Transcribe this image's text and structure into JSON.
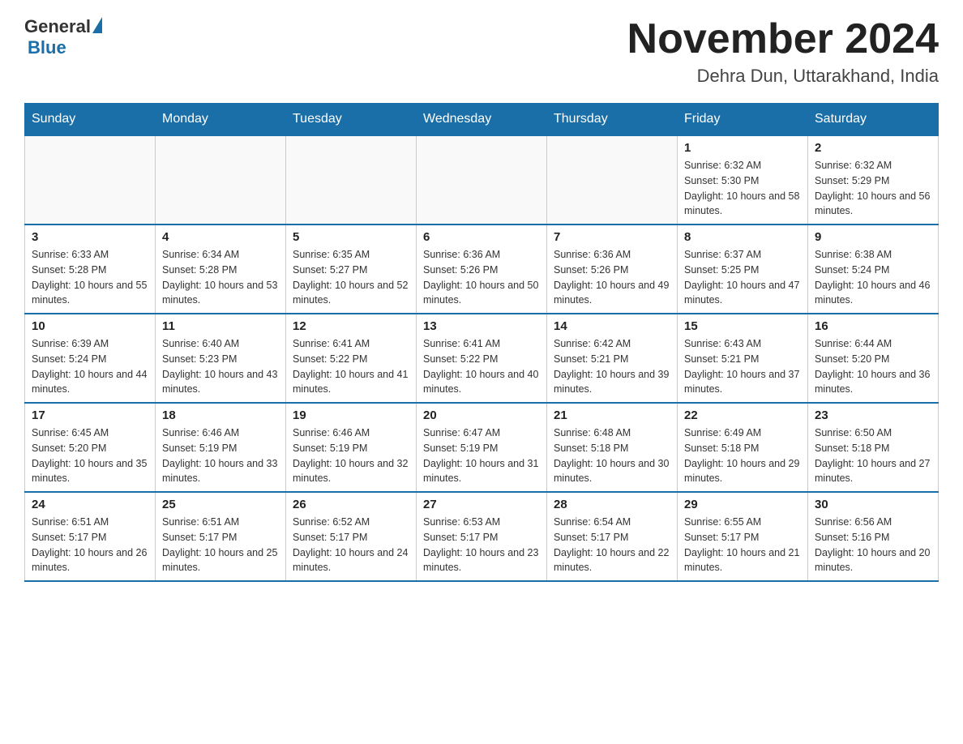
{
  "logo": {
    "general": "General",
    "blue": "Blue"
  },
  "title": "November 2024",
  "subtitle": "Dehra Dun, Uttarakhand, India",
  "days_of_week": [
    "Sunday",
    "Monday",
    "Tuesday",
    "Wednesday",
    "Thursday",
    "Friday",
    "Saturday"
  ],
  "weeks": [
    [
      {
        "day": "",
        "info": ""
      },
      {
        "day": "",
        "info": ""
      },
      {
        "day": "",
        "info": ""
      },
      {
        "day": "",
        "info": ""
      },
      {
        "day": "",
        "info": ""
      },
      {
        "day": "1",
        "info": "Sunrise: 6:32 AM\nSunset: 5:30 PM\nDaylight: 10 hours and 58 minutes."
      },
      {
        "day": "2",
        "info": "Sunrise: 6:32 AM\nSunset: 5:29 PM\nDaylight: 10 hours and 56 minutes."
      }
    ],
    [
      {
        "day": "3",
        "info": "Sunrise: 6:33 AM\nSunset: 5:28 PM\nDaylight: 10 hours and 55 minutes."
      },
      {
        "day": "4",
        "info": "Sunrise: 6:34 AM\nSunset: 5:28 PM\nDaylight: 10 hours and 53 minutes."
      },
      {
        "day": "5",
        "info": "Sunrise: 6:35 AM\nSunset: 5:27 PM\nDaylight: 10 hours and 52 minutes."
      },
      {
        "day": "6",
        "info": "Sunrise: 6:36 AM\nSunset: 5:26 PM\nDaylight: 10 hours and 50 minutes."
      },
      {
        "day": "7",
        "info": "Sunrise: 6:36 AM\nSunset: 5:26 PM\nDaylight: 10 hours and 49 minutes."
      },
      {
        "day": "8",
        "info": "Sunrise: 6:37 AM\nSunset: 5:25 PM\nDaylight: 10 hours and 47 minutes."
      },
      {
        "day": "9",
        "info": "Sunrise: 6:38 AM\nSunset: 5:24 PM\nDaylight: 10 hours and 46 minutes."
      }
    ],
    [
      {
        "day": "10",
        "info": "Sunrise: 6:39 AM\nSunset: 5:24 PM\nDaylight: 10 hours and 44 minutes."
      },
      {
        "day": "11",
        "info": "Sunrise: 6:40 AM\nSunset: 5:23 PM\nDaylight: 10 hours and 43 minutes."
      },
      {
        "day": "12",
        "info": "Sunrise: 6:41 AM\nSunset: 5:22 PM\nDaylight: 10 hours and 41 minutes."
      },
      {
        "day": "13",
        "info": "Sunrise: 6:41 AM\nSunset: 5:22 PM\nDaylight: 10 hours and 40 minutes."
      },
      {
        "day": "14",
        "info": "Sunrise: 6:42 AM\nSunset: 5:21 PM\nDaylight: 10 hours and 39 minutes."
      },
      {
        "day": "15",
        "info": "Sunrise: 6:43 AM\nSunset: 5:21 PM\nDaylight: 10 hours and 37 minutes."
      },
      {
        "day": "16",
        "info": "Sunrise: 6:44 AM\nSunset: 5:20 PM\nDaylight: 10 hours and 36 minutes."
      }
    ],
    [
      {
        "day": "17",
        "info": "Sunrise: 6:45 AM\nSunset: 5:20 PM\nDaylight: 10 hours and 35 minutes."
      },
      {
        "day": "18",
        "info": "Sunrise: 6:46 AM\nSunset: 5:19 PM\nDaylight: 10 hours and 33 minutes."
      },
      {
        "day": "19",
        "info": "Sunrise: 6:46 AM\nSunset: 5:19 PM\nDaylight: 10 hours and 32 minutes."
      },
      {
        "day": "20",
        "info": "Sunrise: 6:47 AM\nSunset: 5:19 PM\nDaylight: 10 hours and 31 minutes."
      },
      {
        "day": "21",
        "info": "Sunrise: 6:48 AM\nSunset: 5:18 PM\nDaylight: 10 hours and 30 minutes."
      },
      {
        "day": "22",
        "info": "Sunrise: 6:49 AM\nSunset: 5:18 PM\nDaylight: 10 hours and 29 minutes."
      },
      {
        "day": "23",
        "info": "Sunrise: 6:50 AM\nSunset: 5:18 PM\nDaylight: 10 hours and 27 minutes."
      }
    ],
    [
      {
        "day": "24",
        "info": "Sunrise: 6:51 AM\nSunset: 5:17 PM\nDaylight: 10 hours and 26 minutes."
      },
      {
        "day": "25",
        "info": "Sunrise: 6:51 AM\nSunset: 5:17 PM\nDaylight: 10 hours and 25 minutes."
      },
      {
        "day": "26",
        "info": "Sunrise: 6:52 AM\nSunset: 5:17 PM\nDaylight: 10 hours and 24 minutes."
      },
      {
        "day": "27",
        "info": "Sunrise: 6:53 AM\nSunset: 5:17 PM\nDaylight: 10 hours and 23 minutes."
      },
      {
        "day": "28",
        "info": "Sunrise: 6:54 AM\nSunset: 5:17 PM\nDaylight: 10 hours and 22 minutes."
      },
      {
        "day": "29",
        "info": "Sunrise: 6:55 AM\nSunset: 5:17 PM\nDaylight: 10 hours and 21 minutes."
      },
      {
        "day": "30",
        "info": "Sunrise: 6:56 AM\nSunset: 5:16 PM\nDaylight: 10 hours and 20 minutes."
      }
    ]
  ]
}
